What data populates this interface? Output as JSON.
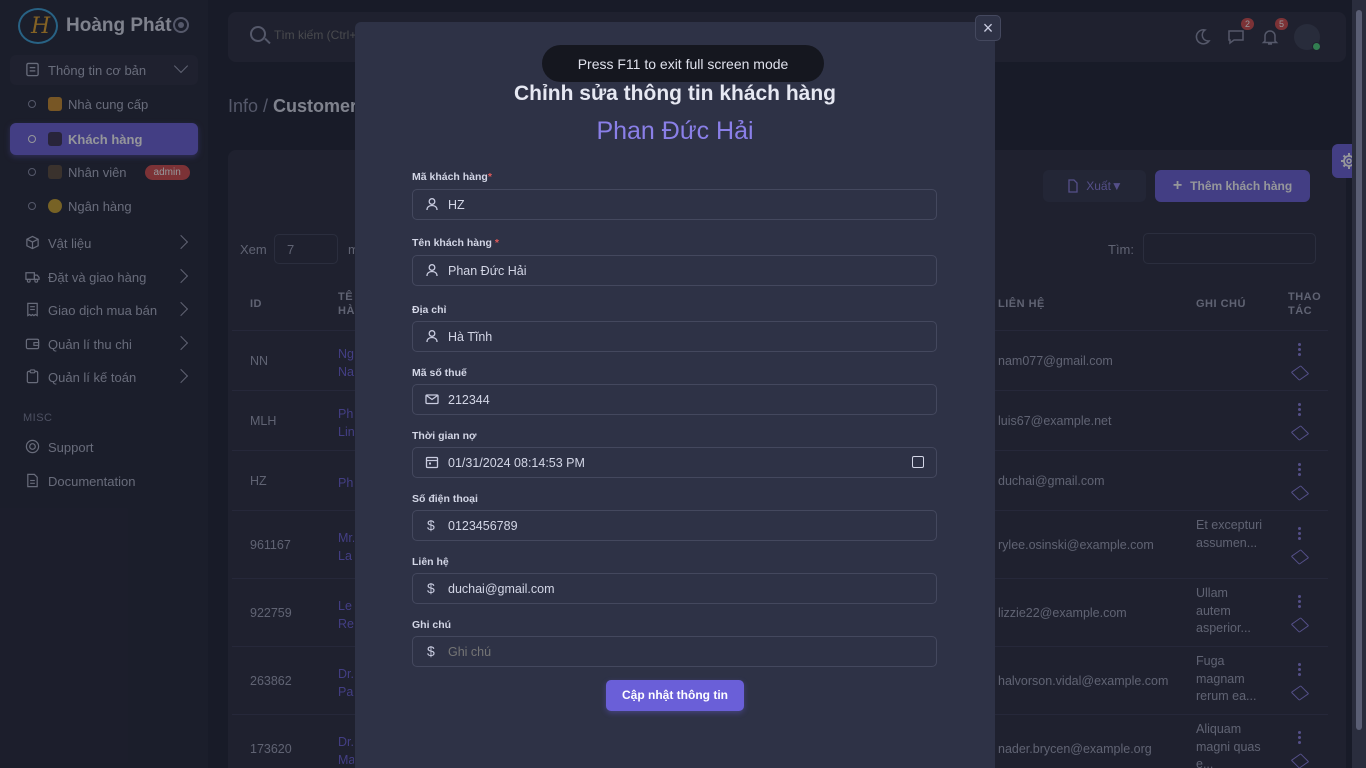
{
  "app": {
    "brand": "Hoàng Phát"
  },
  "sidebar": {
    "groups": [
      {
        "label": "Thông tin cơ bản",
        "icon": "id-card-icon"
      },
      {
        "label": "Vật liệu",
        "icon": "box-icon"
      },
      {
        "label": "Đặt và giao hàng",
        "icon": "truck-icon"
      },
      {
        "label": "Giao dịch mua bán",
        "icon": "receipt-icon"
      },
      {
        "label": "Quản lí thu chi",
        "icon": "wallet-icon"
      },
      {
        "label": "Quản lí kế toán",
        "icon": "clipboard-icon"
      }
    ],
    "subitems": [
      {
        "label": "Nhà cung cấp"
      },
      {
        "label": "Khách hàng"
      },
      {
        "label": "Nhân viên",
        "badge": "admin"
      },
      {
        "label": "Ngân hàng"
      }
    ],
    "misc_label": "MISC",
    "misc": [
      {
        "label": "Support",
        "icon": "lifebuoy-icon"
      },
      {
        "label": "Documentation",
        "icon": "document-icon"
      }
    ]
  },
  "topbar": {
    "search_placeholder": "Tìm kiếm (Ctrl+/)",
    "chat_count": "2",
    "notif_count": "5"
  },
  "breadcrumb": {
    "parent": "Info /",
    "current": "Customer"
  },
  "table": {
    "export_label": "Xuất▼",
    "add_label": "Thêm khách hàng",
    "show_label": "Xem",
    "show_value": "7",
    "show_suffix": "m",
    "search_label": "Tìm:",
    "headers": {
      "id": "ID",
      "name": "TÊ",
      "name2": "HÀ",
      "contact": "LIÊN HỆ",
      "note": "GHI CHÚ",
      "actions": "THAO",
      "actions2": "TÁC"
    },
    "rows": [
      {
        "id": "NN",
        "name": "Ng Na",
        "contact": "nam077@gmail.com",
        "note": ""
      },
      {
        "id": "MLH",
        "name": "Ph Lin",
        "contact": "luis67@example.net",
        "note": ""
      },
      {
        "id": "HZ",
        "name": "Ph",
        "contact": "duchai@gmail.com",
        "note": ""
      },
      {
        "id": "961167",
        "name": "Mr. La",
        "contact": "rylee.osinski@example.com",
        "note": "Et excepturi assumen..."
      },
      {
        "id": "922759",
        "name": "Le Re",
        "contact": "lizzie22@example.com",
        "note": "Ullam autem asperior..."
      },
      {
        "id": "263862",
        "name": "Dr. Pa",
        "contact": "halvorson.vidal@example.com",
        "note": "Fuga magnam rerum ea..."
      },
      {
        "id": "173620",
        "name": "Dr. Ma",
        "contact": "nader.brycen@example.org",
        "note": "Aliquam magni quas e..."
      }
    ]
  },
  "toast": "Press F11 to exit full screen mode",
  "modal": {
    "title": "Chỉnh sửa thông tin khách hàng",
    "customer_name": "Phan Đức Hải",
    "close": "×",
    "fields": [
      {
        "label": "Mã khách hàng",
        "required": "*",
        "value": "HZ",
        "icon": "user-icon"
      },
      {
        "label": "Tên khách hàng",
        "required": "*",
        "value": "Phan Đức Hải",
        "icon": "user-icon"
      },
      {
        "label": "Địa chỉ",
        "required": "",
        "value": "Hà Tĩnh",
        "icon": "user-icon"
      },
      {
        "label": "Mã số thuế",
        "required": "",
        "value": "212344",
        "icon": "mail-icon"
      },
      {
        "label": "Thời gian nợ",
        "required": "",
        "value": "01/31/2024 08:14:53 PM",
        "icon": "calendar-icon"
      },
      {
        "label": "Số điện thoại",
        "required": "",
        "value": "0123456789",
        "icon": "dollar-icon"
      },
      {
        "label": "Liên hệ",
        "required": "",
        "value": "duchai@gmail.com",
        "icon": "dollar-icon"
      },
      {
        "label": "Ghi chú",
        "required": "",
        "value": "",
        "placeholder": "Ghi chú",
        "icon": "dollar-icon"
      }
    ],
    "submit_label": "Cập nhật thông tin"
  },
  "colors": {
    "accent": "#6a5fd8",
    "background": "#1d2030",
    "danger": "#d24a4a"
  }
}
